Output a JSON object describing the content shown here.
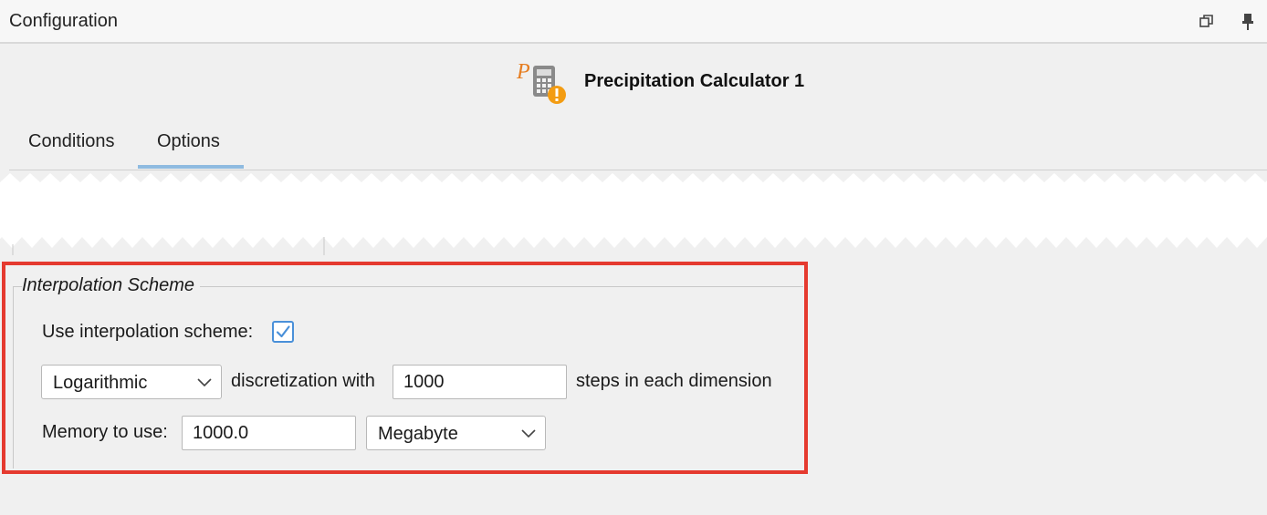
{
  "window": {
    "title": "Configuration",
    "restore_icon": "restore-window-icon",
    "pin_icon": "pin-icon"
  },
  "header": {
    "title": "Precipitation Calculator 1",
    "icon": "precipitation-calculator-warning-icon",
    "icon_letter": "P"
  },
  "tabs": [
    {
      "label": "Conditions",
      "selected": false
    },
    {
      "label": "Options",
      "selected": true
    }
  ],
  "interpolation": {
    "group_title": "Interpolation Scheme",
    "use_label": "Use interpolation scheme:",
    "use_checked": true,
    "scheme_value": "Logarithmic",
    "discretization_label": "discretization with",
    "steps_value": "1000",
    "steps_label": "steps in each dimension",
    "memory_label": "Memory to use:",
    "memory_value": "1000.0",
    "memory_unit": "Megabyte"
  },
  "colors": {
    "highlight": "#e53a2f",
    "tab_indicator": "#8fbbe0",
    "checkbox": "#4a90d9",
    "icon_orange": "#f39c12"
  }
}
